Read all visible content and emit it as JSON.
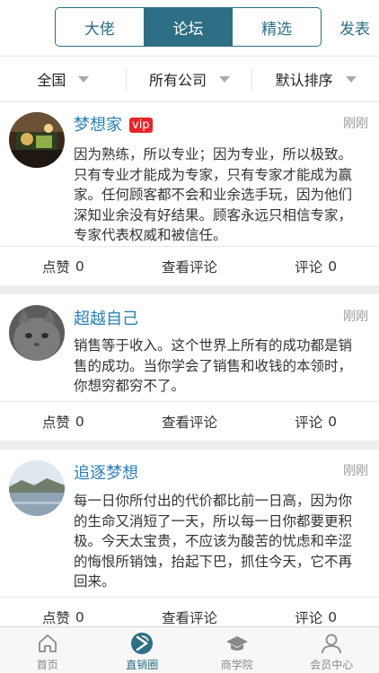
{
  "header": {
    "tabs": [
      {
        "label": "大佬"
      },
      {
        "label": "论坛"
      },
      {
        "label": "精选"
      }
    ],
    "active_tab": 1,
    "post_label": "发表"
  },
  "filters": [
    {
      "label": "全国"
    },
    {
      "label": "所有公司"
    },
    {
      "label": "默认排序"
    }
  ],
  "posts": [
    {
      "username": "梦想家",
      "badge": "vip",
      "time": "刚刚",
      "content": "因为熟练，所以专业；因为专业，所以极致。只有专业才能成为专家，只有专家才能成为赢家。任何顾客都不会和业余选手玩，因为他们深知业余没有好结果。顾客永远只相信专家，专家代表权威和被信任。",
      "like_label": "点赞",
      "like_count": "0",
      "view_comments_label": "查看评论",
      "comment_label": "评论",
      "comment_count": "0"
    },
    {
      "username": "超越自己",
      "time": "刚刚",
      "content": "销售等于收入。这个世界上所有的成功都是销售的成功。当你学会了销售和收钱的本领时，你想穷都穷不了。",
      "like_label": "点赞",
      "like_count": "0",
      "view_comments_label": "查看评论",
      "comment_label": "评论",
      "comment_count": "0"
    },
    {
      "username": "追逐梦想",
      "time": "刚刚",
      "content": "每一日你所付出的代价都比前一日高，因为你的生命又消短了一天，所以每一日你都要更积极。今天太宝贵，不应该为酸苦的忧虑和辛涩的悔恨所销蚀，抬起下巴，抓住今天，它不再回来。",
      "like_label": "点赞",
      "like_count": "0",
      "view_comments_label": "查看评论",
      "comment_label": "评论",
      "comment_count": "0"
    }
  ],
  "tabbar": [
    {
      "label": "首页",
      "icon": "home-icon"
    },
    {
      "label": "直销圈",
      "icon": "circle-icon"
    },
    {
      "label": "商学院",
      "icon": "graduation-cap-icon"
    },
    {
      "label": "会员中心",
      "icon": "user-icon"
    }
  ],
  "active_tabbar": 1,
  "colors": {
    "accent": "#2e6f85",
    "username": "#2a7fb5",
    "vip": "#e8232b"
  }
}
